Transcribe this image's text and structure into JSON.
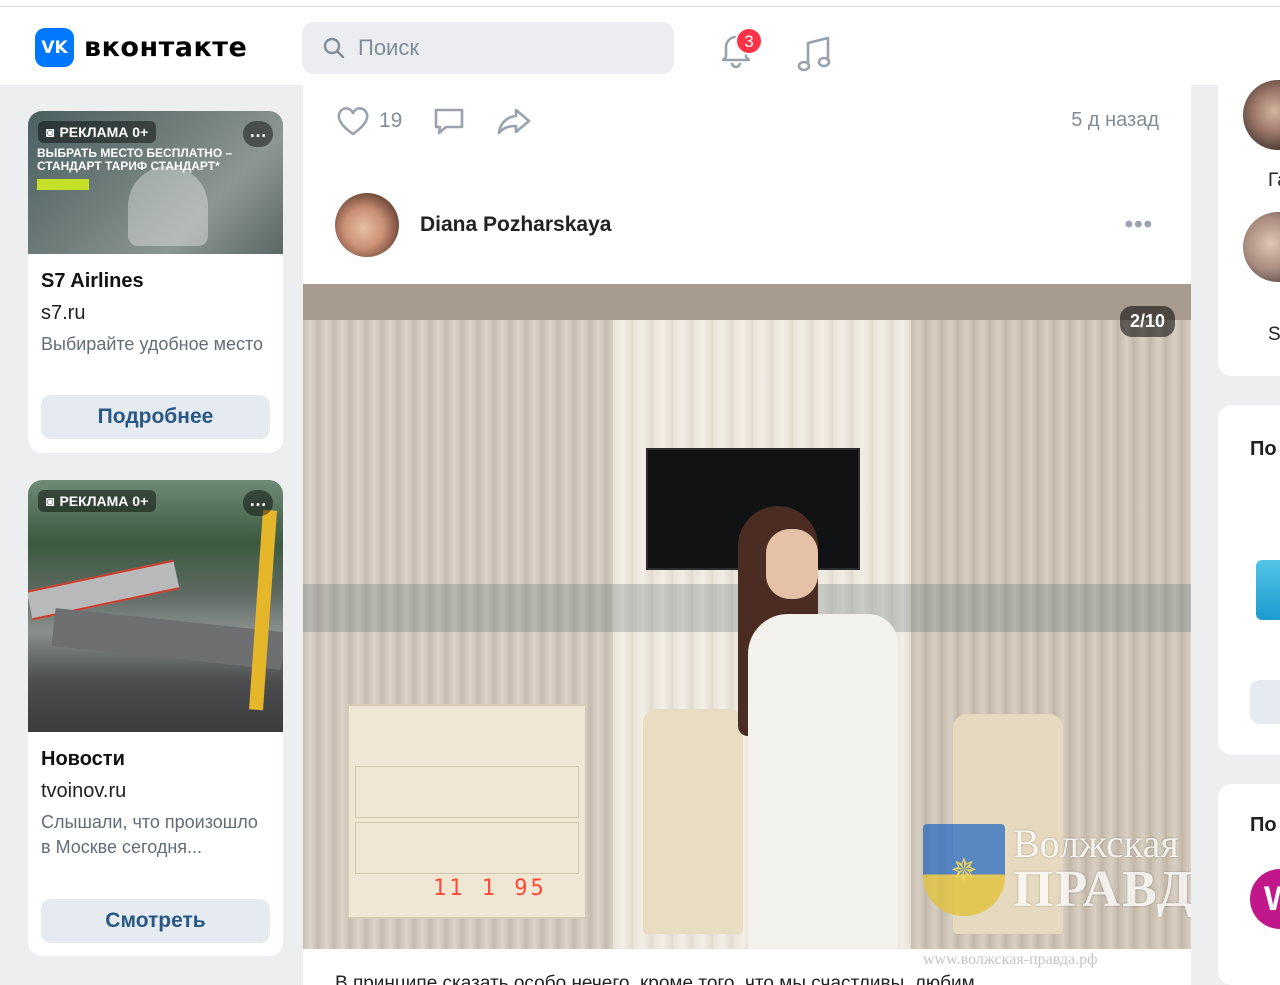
{
  "header": {
    "logo_short": "VK",
    "logo_text": "вконтакте",
    "search_placeholder": "Поиск",
    "notifications_count": "3"
  },
  "ads": [
    {
      "label": "РЕКЛАМА 0+",
      "image_headline": "ВЫБРАТЬ МЕСТО БЕСПЛАТНО – СТАНДАРТ ТАРИФ СТАНДАРТ*",
      "title": "S7 Airlines",
      "domain": "s7.ru",
      "description": "Выбирайте удобное место",
      "button": "Подробнее"
    },
    {
      "label": "РЕКЛАМА 0+",
      "title": "Новости",
      "domain": "tvoinov.ru",
      "description": "Слышали, что произошло в Москве сегодня...",
      "button": "Смотреть"
    }
  ],
  "post": {
    "likes": "19",
    "time": "5 д назад",
    "author": "Diana Pozharskaya",
    "photo_counter": "2/10",
    "clock_display": "11 1 95",
    "text": "В принципе сказать особо нечего, кроме того, что мы счастливы, любим"
  },
  "watermark": {
    "line1": "Волжская",
    "line2": "ПРАВДА",
    "url": "www.волжская-правда.рф"
  },
  "right_column": {
    "friend1_name": "Га",
    "friend2_name": "S",
    "section1_title": "По",
    "section2_title": "По",
    "community_logo": "W"
  }
}
